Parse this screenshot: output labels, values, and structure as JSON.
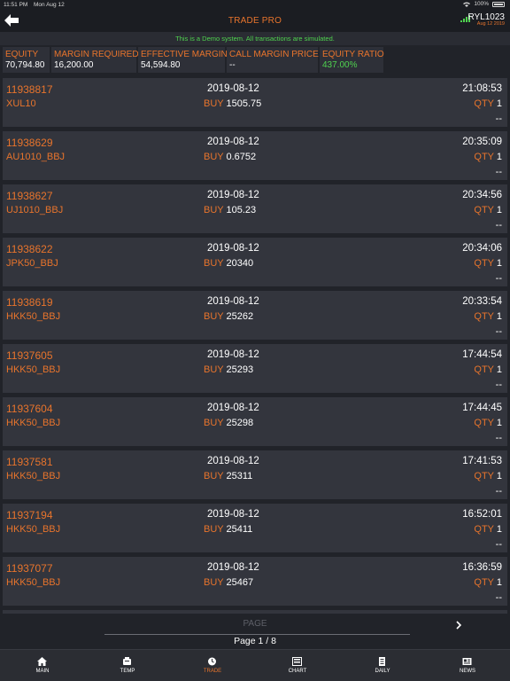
{
  "status_bar": {
    "time": "11:51 PM",
    "date": "Mon Aug 12",
    "battery": "100%"
  },
  "header": {
    "title": "TRADE PRO",
    "account": "RYL1023",
    "account_date": "Aug 12 2019"
  },
  "demo_notice": "This is a Demo system. All transactions are simulated.",
  "summary": [
    {
      "label": "EQUITY",
      "value": "70,794.80"
    },
    {
      "label": "MARGIN REQUIRED",
      "value": "16,200.00"
    },
    {
      "label": "EFFECTIVE MARGIN",
      "value": "54,594.80"
    },
    {
      "label": "CALL MARGIN PRICE",
      "value": "--"
    },
    {
      "label": "EQUITY RATIO",
      "value": "437.00%"
    }
  ],
  "trades": [
    {
      "id": "11938817",
      "date": "2019-08-12",
      "time": "21:08:53",
      "symbol": "XUL10",
      "side": "BUY",
      "price": "1505.75",
      "qty_label": "QTY",
      "qty": "1",
      "extra": "--"
    },
    {
      "id": "11938629",
      "date": "2019-08-12",
      "time": "20:35:09",
      "symbol": "AU1010_BBJ",
      "side": "BUY",
      "price": "0.6752",
      "qty_label": "QTY",
      "qty": "1",
      "extra": "--"
    },
    {
      "id": "11938627",
      "date": "2019-08-12",
      "time": "20:34:56",
      "symbol": "UJ1010_BBJ",
      "side": "BUY",
      "price": "105.23",
      "qty_label": "QTY",
      "qty": "1",
      "extra": "--"
    },
    {
      "id": "11938622",
      "date": "2019-08-12",
      "time": "20:34:06",
      "symbol": "JPK50_BBJ",
      "side": "BUY",
      "price": "20340",
      "qty_label": "QTY",
      "qty": "1",
      "extra": "--"
    },
    {
      "id": "11938619",
      "date": "2019-08-12",
      "time": "20:33:54",
      "symbol": "HKK50_BBJ",
      "side": "BUY",
      "price": "25262",
      "qty_label": "QTY",
      "qty": "1",
      "extra": "--"
    },
    {
      "id": "11937605",
      "date": "2019-08-12",
      "time": "17:44:54",
      "symbol": "HKK50_BBJ",
      "side": "BUY",
      "price": "25293",
      "qty_label": "QTY",
      "qty": "1",
      "extra": "--"
    },
    {
      "id": "11937604",
      "date": "2019-08-12",
      "time": "17:44:45",
      "symbol": "HKK50_BBJ",
      "side": "BUY",
      "price": "25298",
      "qty_label": "QTY",
      "qty": "1",
      "extra": "--"
    },
    {
      "id": "11937581",
      "date": "2019-08-12",
      "time": "17:41:53",
      "symbol": "HKK50_BBJ",
      "side": "BUY",
      "price": "25311",
      "qty_label": "QTY",
      "qty": "1",
      "extra": "--"
    },
    {
      "id": "11937194",
      "date": "2019-08-12",
      "time": "16:52:01",
      "symbol": "HKK50_BBJ",
      "side": "BUY",
      "price": "25411",
      "qty_label": "QTY",
      "qty": "1",
      "extra": "--"
    },
    {
      "id": "11937077",
      "date": "2019-08-12",
      "time": "16:36:59",
      "symbol": "HKK50_BBJ",
      "side": "BUY",
      "price": "25467",
      "qty_label": "QTY",
      "qty": "1",
      "extra": "--"
    }
  ],
  "pager": {
    "label": "PAGE",
    "page_text": "Page 1 / 8"
  },
  "tabs": [
    {
      "label": "MAIN",
      "icon": "home-icon",
      "active": false
    },
    {
      "label": "TEMP",
      "icon": "temp-icon",
      "active": false
    },
    {
      "label": "TRADE",
      "icon": "clock-icon",
      "active": true
    },
    {
      "label": "CHART",
      "icon": "chart-icon",
      "active": false
    },
    {
      "label": "DAILY",
      "icon": "document-icon",
      "active": false
    },
    {
      "label": "NEWS",
      "icon": "news-icon",
      "active": false
    }
  ],
  "colors": {
    "accent": "#e8742c",
    "positive": "#4fd34f",
    "background": "#212329",
    "row": "#33353d"
  }
}
